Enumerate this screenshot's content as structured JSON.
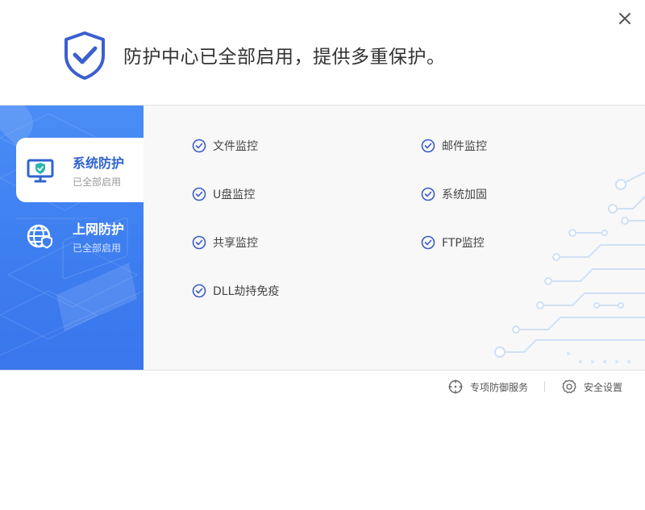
{
  "header": {
    "title": "防护中心已全部启用，提供多重保护。"
  },
  "sidebar": {
    "items": [
      {
        "title": "系统防护",
        "status": "已全部启用",
        "icon": "monitor-shield-icon",
        "active": true
      },
      {
        "title": "上网防护",
        "status": "已全部启用",
        "icon": "globe-shield-icon",
        "active": false
      }
    ]
  },
  "features": {
    "col1": [
      "文件监控",
      "U盘监控",
      "共享监控",
      "DLL劫持免疫"
    ],
    "col2": [
      "邮件监控",
      "系统加固",
      "FTP监控"
    ]
  },
  "footer": {
    "service_label": "专项防御服务",
    "settings_label": "安全设置"
  },
  "colors": {
    "accent": "#3b6fd8",
    "sidebar": "#3d7ef0",
    "check": "#3a5bc7"
  }
}
